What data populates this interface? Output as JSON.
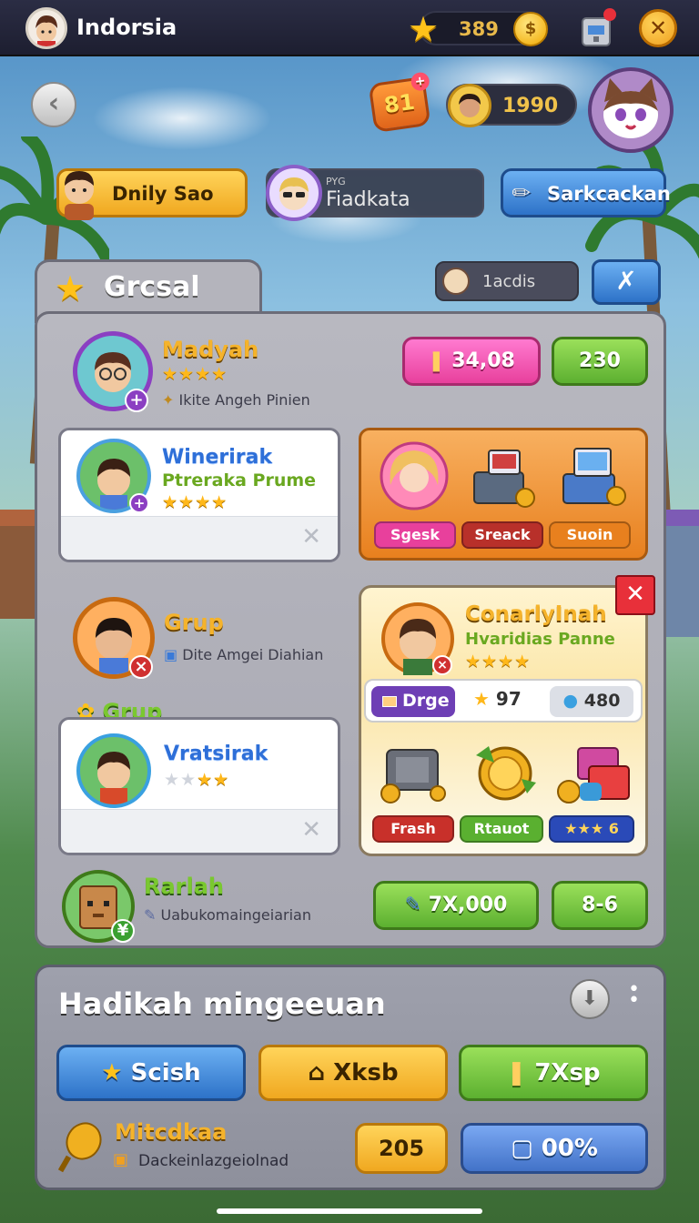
{
  "topbar": {
    "title": "Indorsia",
    "currency_value": "389",
    "coin_symbol": "$",
    "close_symbol": "✕"
  },
  "header": {
    "back_symbol": "‹",
    "level_value": "81",
    "gems_value": "1990"
  },
  "actions": {
    "daily_label": "Dnily Sao",
    "friend_tag": "PYG",
    "friend_name": "Fiadkata",
    "search_label": "Sarkcackan"
  },
  "panel": {
    "title": "Grcsal",
    "members_label": "1acdis",
    "rows": [
      {
        "name": "Madyah",
        "stars": "★★★★",
        "sub": "Ikite Angeh Pinien",
        "btn1": "34,08",
        "btn2": "230"
      },
      {
        "name": "Grup",
        "sub": "Dite Amgei Diahian"
      },
      {
        "name": "Rarlah",
        "sub": "Uabukomaingeiarian",
        "btn1": "7X,000",
        "btn2": "8-6"
      }
    ],
    "card1": {
      "name": "Winerirak",
      "sub": "Ptreraka Prume",
      "stars": "★★★★"
    },
    "card2": {
      "label": "Grup",
      "name": "Vratsirak",
      "stars_off": "★★",
      "stars_on": "★★"
    },
    "card_x": "✕",
    "orange_card": {
      "tags": [
        "Sgesk",
        "Sreack",
        "Suoin"
      ]
    },
    "featured": {
      "name": "ConarlyInah",
      "sub": "Hvaridias Panne",
      "stars": "★★★★",
      "stat_label": "Drge",
      "stat_star": "97",
      "stat_gem": "480",
      "tags": [
        "Frash",
        "Rtauot",
        "★★★"
      ],
      "tag3_num": "6",
      "close": "✕"
    }
  },
  "bottom": {
    "title": "Hadikah mingeeuan",
    "buttons": [
      "Scish",
      "Xksb",
      "7Xsp"
    ],
    "foot_name": "Mitcdkaa",
    "foot_sub": "Dackeinlazgeiolnad",
    "value1": "205",
    "value2": "00%"
  }
}
